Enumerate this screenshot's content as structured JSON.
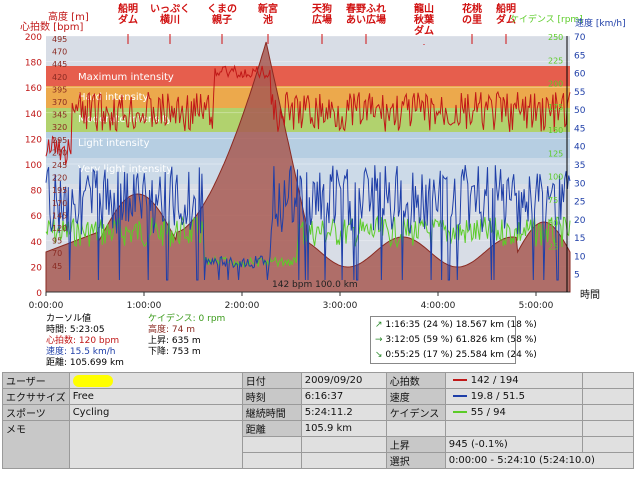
{
  "colors": {
    "hr": "#c01818",
    "speed": "#1f3fa8",
    "cadence": "#5ccc28",
    "altitude_fill": "#a85a52",
    "zone_max": "#e8503c",
    "zone_hard": "#f0a030",
    "zone_mod": "#a8d050",
    "zone_light": "#a8c8e0",
    "zone_vlight": "#c8d8e8"
  },
  "axis": {
    "altitude_label": "高度 [m]",
    "hr_label": "心拍数 [bpm]",
    "cadence_label": "ケイデンス [rpm]",
    "speed_label": "速度 [km/h]",
    "time_label": "時間",
    "hr_ticks": [
      "200",
      "180",
      "160",
      "140",
      "120",
      "100",
      "80",
      "60",
      "40",
      "20",
      "0"
    ],
    "alt_ticks": [
      "495",
      "470",
      "445",
      "420",
      "395",
      "370",
      "345",
      "320",
      "295",
      "270",
      "245",
      "220",
      "195",
      "170",
      "145",
      "120",
      "95",
      "70",
      "45"
    ],
    "speed_ticks": [
      "70",
      "65",
      "60",
      "55",
      "50",
      "45",
      "40",
      "35",
      "30",
      "25",
      "20",
      "15",
      "10",
      "5"
    ],
    "cad_ticks": [
      "250",
      "225",
      "200",
      "175",
      "150",
      "125",
      "100",
      "75",
      "50",
      "25"
    ],
    "time_ticks": [
      "0:00:00",
      "1:00:00",
      "2:00:00",
      "3:00:00",
      "4:00:00",
      "5:00:00"
    ]
  },
  "zones": [
    "Maximum intensity",
    "Hard intensity",
    "Moderate intensity",
    "Light intensity",
    "Very light intensity"
  ],
  "landmarks": [
    {
      "label": "船明\nダム"
    },
    {
      "label": "いっぷく\n横川"
    },
    {
      "label": "くまの\n親子"
    },
    {
      "label": "新宮\n池"
    },
    {
      "label": "天狗\n広場"
    },
    {
      "label": "春野ふれ\nあい広場"
    },
    {
      "label": "龍山\n秋葉\nダム"
    },
    {
      "label": "花桃\nの里"
    },
    {
      "label": "船明\nダム"
    }
  ],
  "cursor_readout": "142 bpm 100.0 km",
  "cursor": {
    "title": "カーソル値",
    "time": "時間: 5:23:05",
    "hr": "心拍数: 120 bpm",
    "speed": "速度: 15.5 km/h",
    "distance": "距離: 105.699 km",
    "cadence": "ケイデンス: 0 rpm",
    "altitude": "高度: 74 m",
    "ascent": "上昇: 635 m",
    "descent": "下降: 753 m"
  },
  "summary": [
    {
      "arrow": "↗",
      "text": "1:16:35  (24 %) 18.567 km  (18 %)",
      "color": "#2a8a2a"
    },
    {
      "arrow": "→",
      "text": "3:12:05  (59 %) 61.826 km  (58 %)",
      "color": "#2a8a2a"
    },
    {
      "arrow": "↘",
      "text": "0:55:25  (17 %) 25.584 km  (24 %)",
      "color": "#2a8a2a"
    }
  ],
  "info": {
    "user_label": "ユーザー",
    "exercise_label": "エクササイズ",
    "exercise_value": "Free",
    "sport_label": "スポーツ",
    "sport_value": "Cycling",
    "memo_label": "メモ",
    "date_label": "日付",
    "date_value": "2009/09/20",
    "time_label": "時刻",
    "time_value": "6:16:37",
    "duration_label": "継続時間",
    "duration_value": "5:24:11.2",
    "distance_label": "距離",
    "distance_value": "105.9 km",
    "hr_label": "心拍数",
    "hr_value": "142 / 194",
    "speed_label": "速度",
    "speed_value": "19.8 / 51.5",
    "cadence_label": "ケイデンス",
    "cadence_value": "55 / 94",
    "ascent_label": "上昇",
    "ascent_value": "945 (-0.1%)",
    "select_label": "選択",
    "select_value": "0:00:00 - 5:24:10 (5:24:10.0)"
  }
}
